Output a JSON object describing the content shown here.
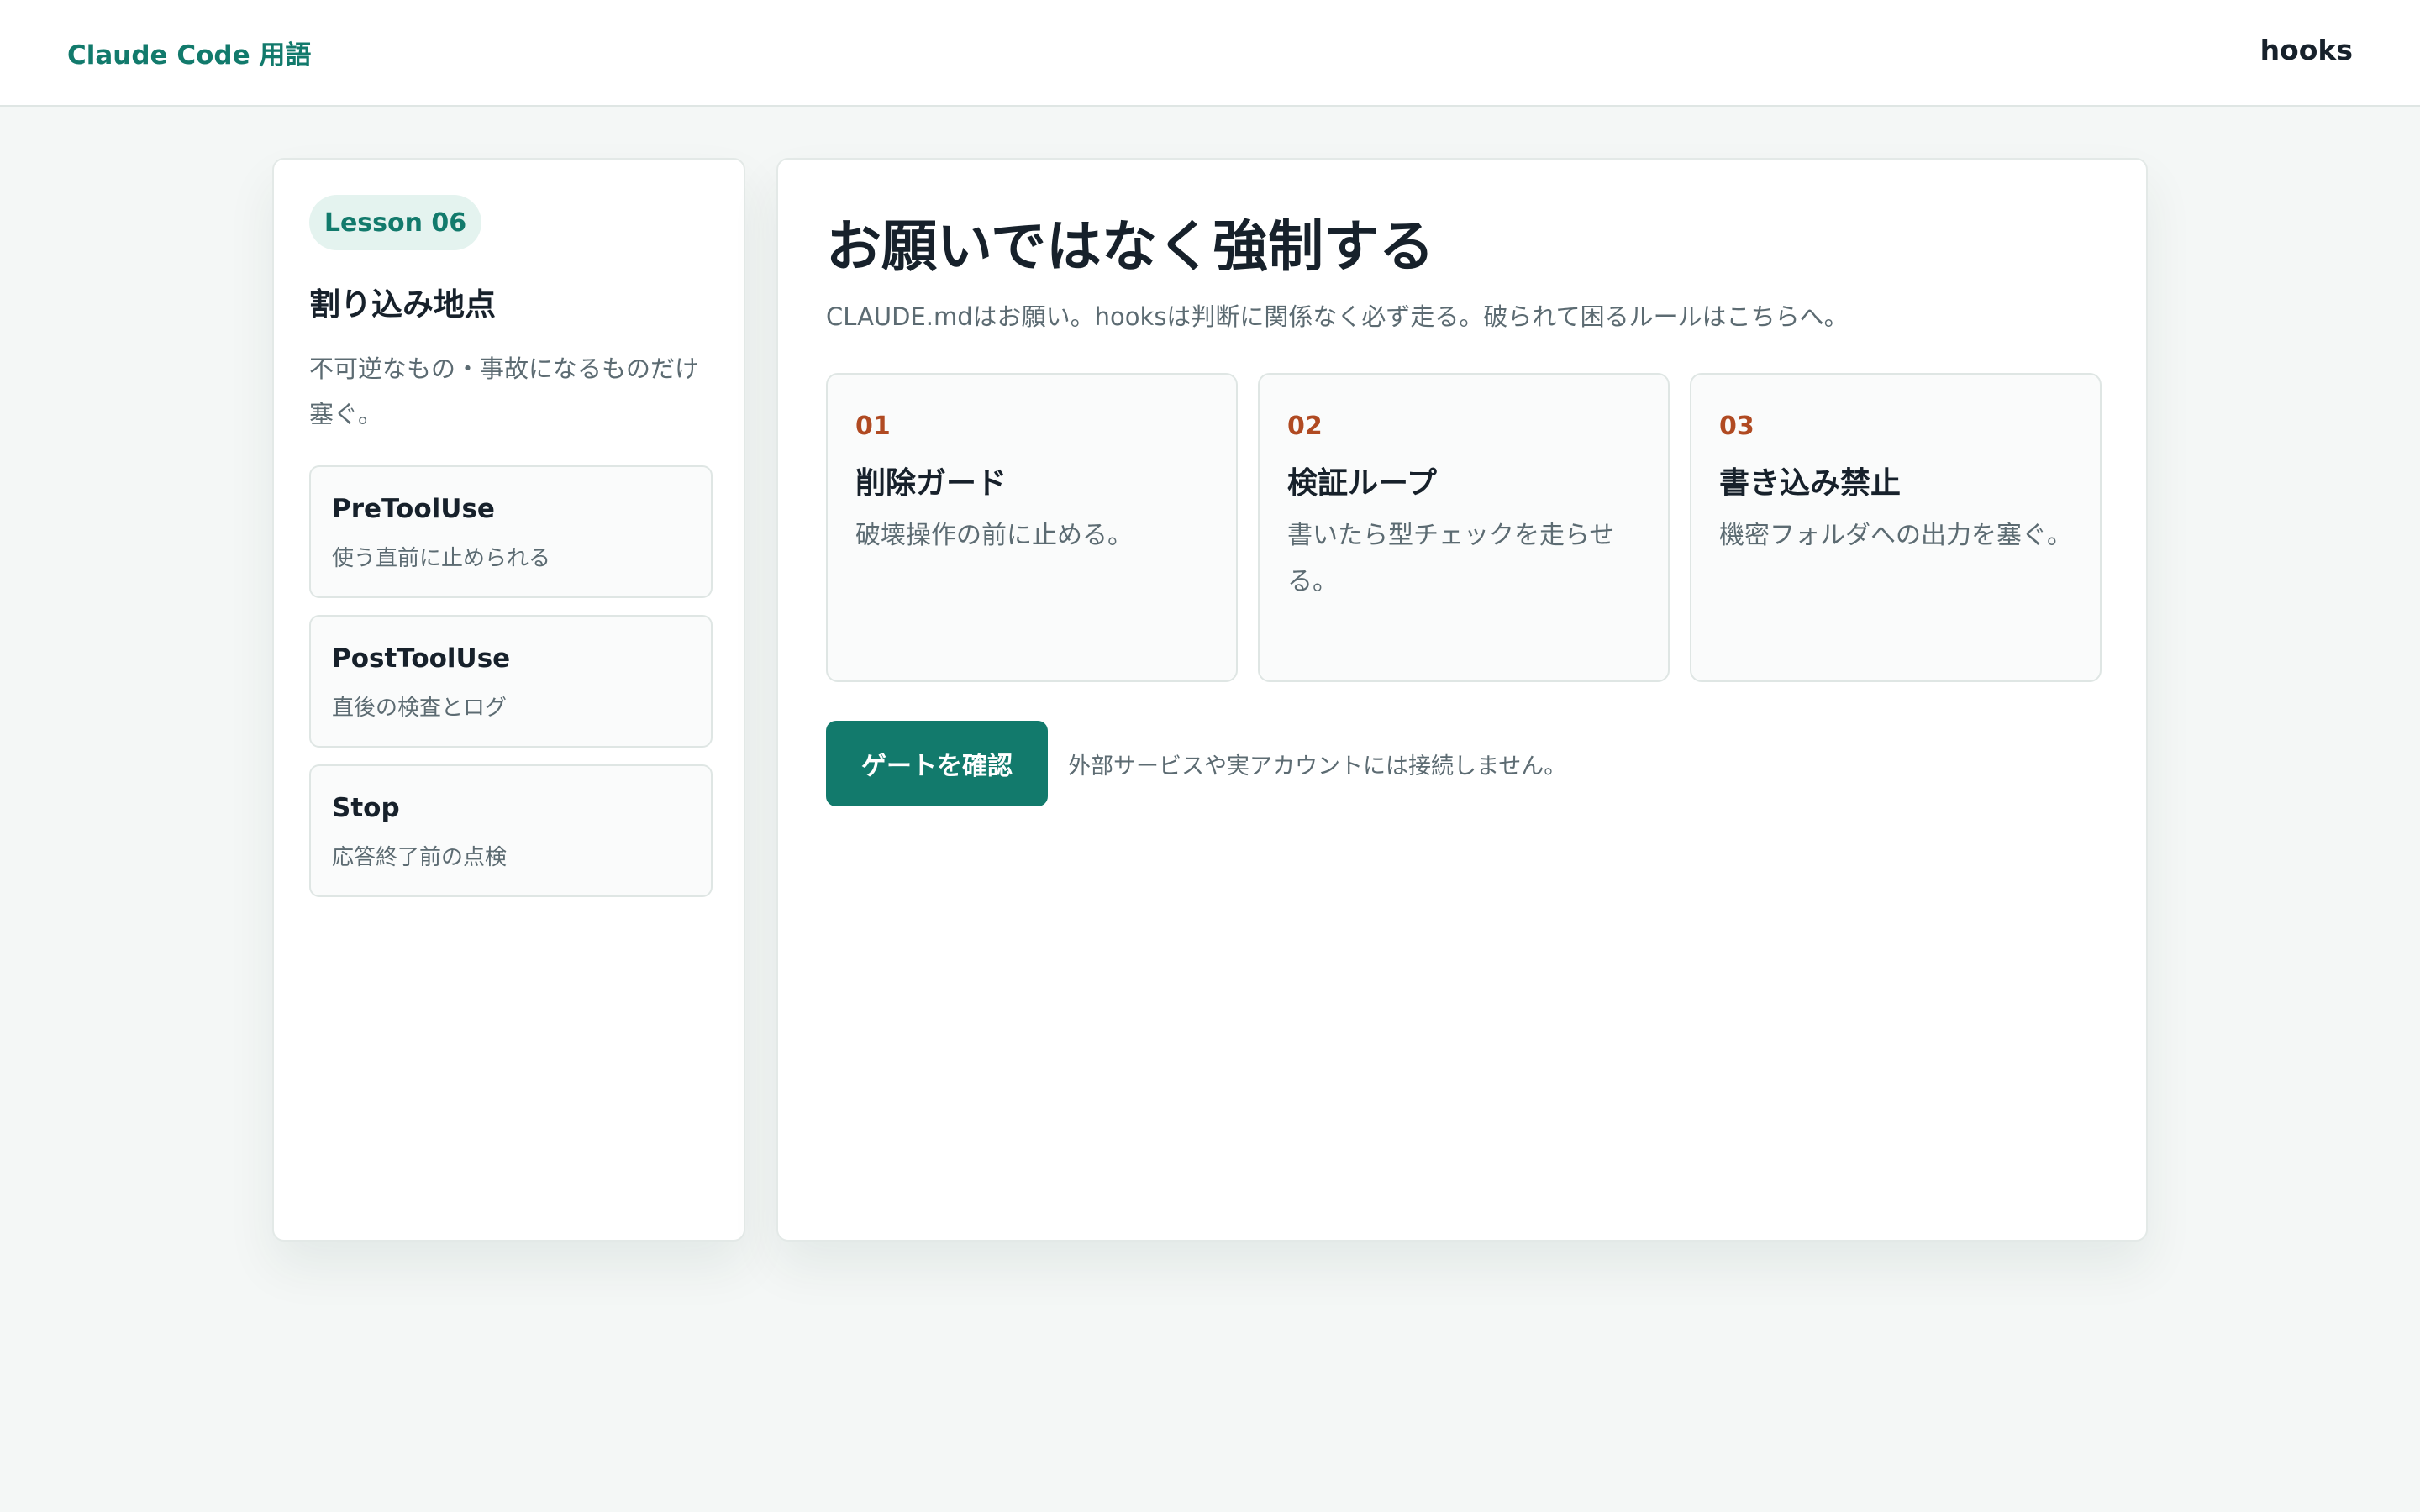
{
  "header": {
    "brand": "Claude Code 用語",
    "topic": "hooks"
  },
  "sidebar": {
    "lesson": "Lesson 06",
    "title": "割り込み地点",
    "description": "不可逆なもの・事故になるものだけ塞ぐ。",
    "events": [
      {
        "name": "PreToolUse",
        "desc": "使う直前に止められる"
      },
      {
        "name": "PostToolUse",
        "desc": "直後の検査とログ"
      },
      {
        "name": "Stop",
        "desc": "応答終了前の点検"
      }
    ]
  },
  "main": {
    "title": "お願いではなく強制する",
    "description": "CLAUDE.mdはお願い。hooksは判断に関係なく必ず走る。破られて困るルールはこちらへ。",
    "steps": [
      {
        "num": "01",
        "title": "削除ガード",
        "desc": "破壊操作の前に止める。"
      },
      {
        "num": "02",
        "title": "検証ループ",
        "desc": "書いたら型チェックを走らせる。"
      },
      {
        "num": "03",
        "title": "書き込み禁止",
        "desc": "機密フォルダへの出力を塞ぐ。"
      }
    ],
    "button_label": "ゲートを確認",
    "note": "外部サービスや実アカウントには接続しません。"
  },
  "colors": {
    "accent": "#127a6c",
    "number_accent": "#b04a22",
    "background": "#f4f7f6"
  }
}
